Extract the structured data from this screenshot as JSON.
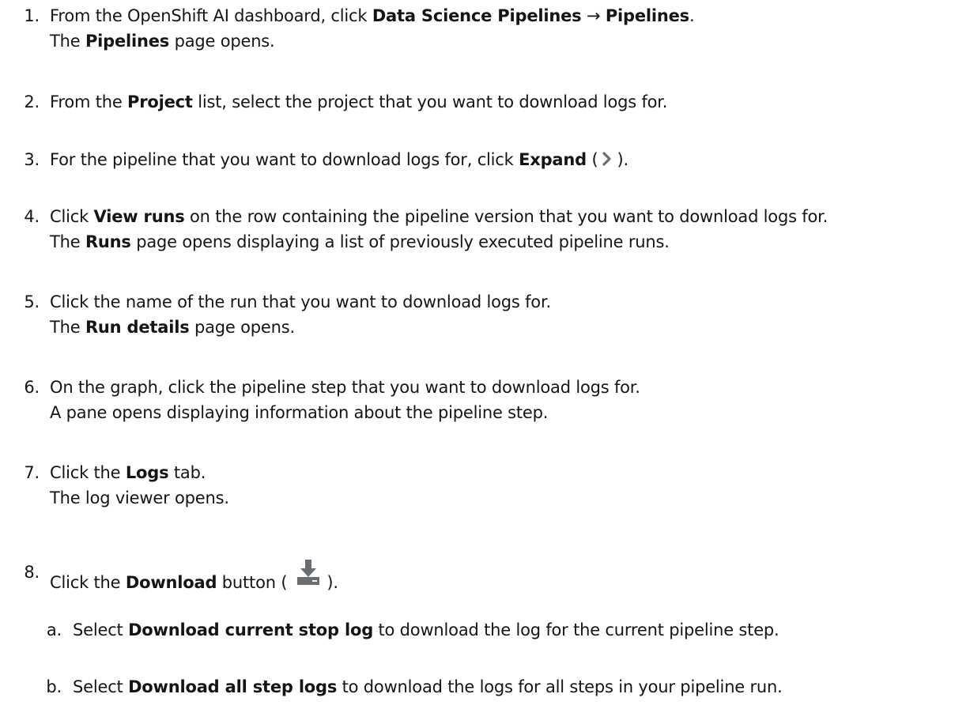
{
  "steps": [
    {
      "num": "1.",
      "pre": "From the OpenShift AI dashboard, click ",
      "b1": "Data Science Pipelines",
      "mid": " → ",
      "b2": "Pipelines",
      "post": ".",
      "l2pre": "The ",
      "l2b": "Pipelines",
      "l2post": " page opens."
    },
    {
      "num": "2.",
      "pre": "From the ",
      "b1": "Project",
      "post": " list, select the project that you want to download logs for."
    },
    {
      "num": "3.",
      "pre": "For the pipeline that you want to download logs for, click ",
      "b1": "Expand",
      "open": " (",
      "close": ")."
    },
    {
      "num": "4.",
      "pre": "Click ",
      "b1": "View runs",
      "post": " on the row containing the pipeline version that you want to download logs for.",
      "l2pre": "The ",
      "l2b": "Runs",
      "l2post": " page opens displaying a list of previously executed pipeline runs."
    },
    {
      "num": "5.",
      "pre": "Click the name of the run that you want to download logs for.",
      "l2pre": "The ",
      "l2b": "Run details",
      "l2post": " page opens."
    },
    {
      "num": "6.",
      "pre": "On the graph, click the pipeline step that you want to download logs for.",
      "l2pre": "A pane opens displaying information about the pipeline step."
    },
    {
      "num": "7.",
      "pre": "Click the ",
      "b1": "Logs",
      "post": " tab.",
      "l2pre": "The log viewer opens."
    },
    {
      "num": "8.",
      "pre": "Click the ",
      "b1": "Download",
      "post": " button (",
      "close": ")."
    }
  ],
  "substeps": [
    {
      "num": "a.",
      "pre": "Select ",
      "b1": "Download current stop log",
      "post": " to download the log for the current pipeline step."
    },
    {
      "num": "b.",
      "pre": "Select ",
      "b1": "Download all step logs",
      "post": " to download the logs for all steps in your pipeline run."
    }
  ],
  "icons": {
    "expand": "chevron-right-icon",
    "download": "download-icon"
  },
  "colors": {
    "text": "#151515",
    "icon": "#6a6e73"
  }
}
